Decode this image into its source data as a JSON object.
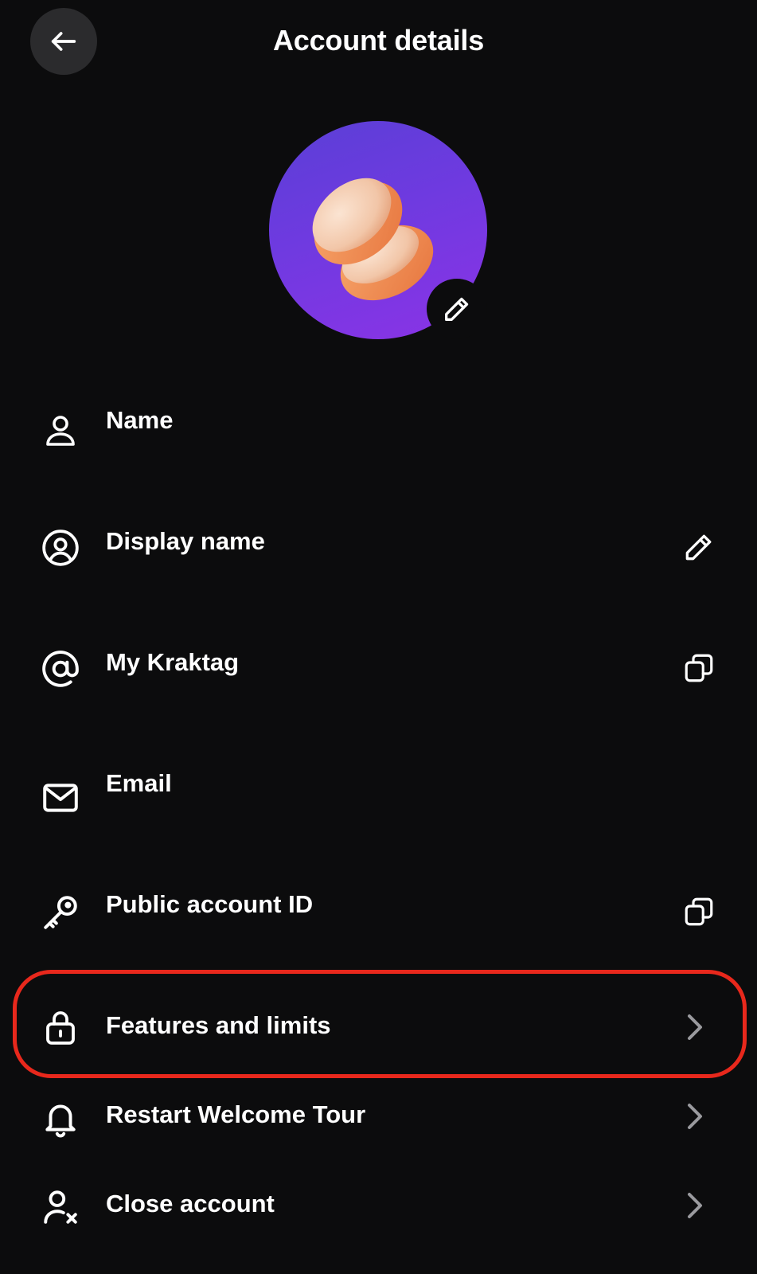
{
  "header": {
    "title": "Account details",
    "back_icon": "arrow-left-icon"
  },
  "avatar": {
    "edit_icon": "pencil-icon"
  },
  "rows": [
    {
      "label": "Name",
      "icon": "user-icon",
      "action": null
    },
    {
      "label": "Display name",
      "icon": "user-circle-icon",
      "action": "pencil-icon"
    },
    {
      "label": "My Kraktag",
      "icon": "at-sign-icon",
      "action": "copy-icon"
    },
    {
      "label": "Email",
      "icon": "mail-icon",
      "action": null
    },
    {
      "label": "Public account ID",
      "icon": "key-icon",
      "action": "copy-icon"
    },
    {
      "label": "Features and limits",
      "icon": "lock-icon",
      "action": "chevron-right-icon"
    },
    {
      "label": "Restart Welcome Tour",
      "icon": "bell-icon",
      "action": "chevron-right-icon"
    },
    {
      "label": "Close account",
      "icon": "user-remove-icon",
      "action": "chevron-right-icon"
    }
  ],
  "colors": {
    "background": "#0c0c0d",
    "highlight": "#e8281c",
    "avatar_gradient_start": "#5a3fd6",
    "avatar_gradient_end": "#8b33e6",
    "muted": "#9a9a9e"
  }
}
